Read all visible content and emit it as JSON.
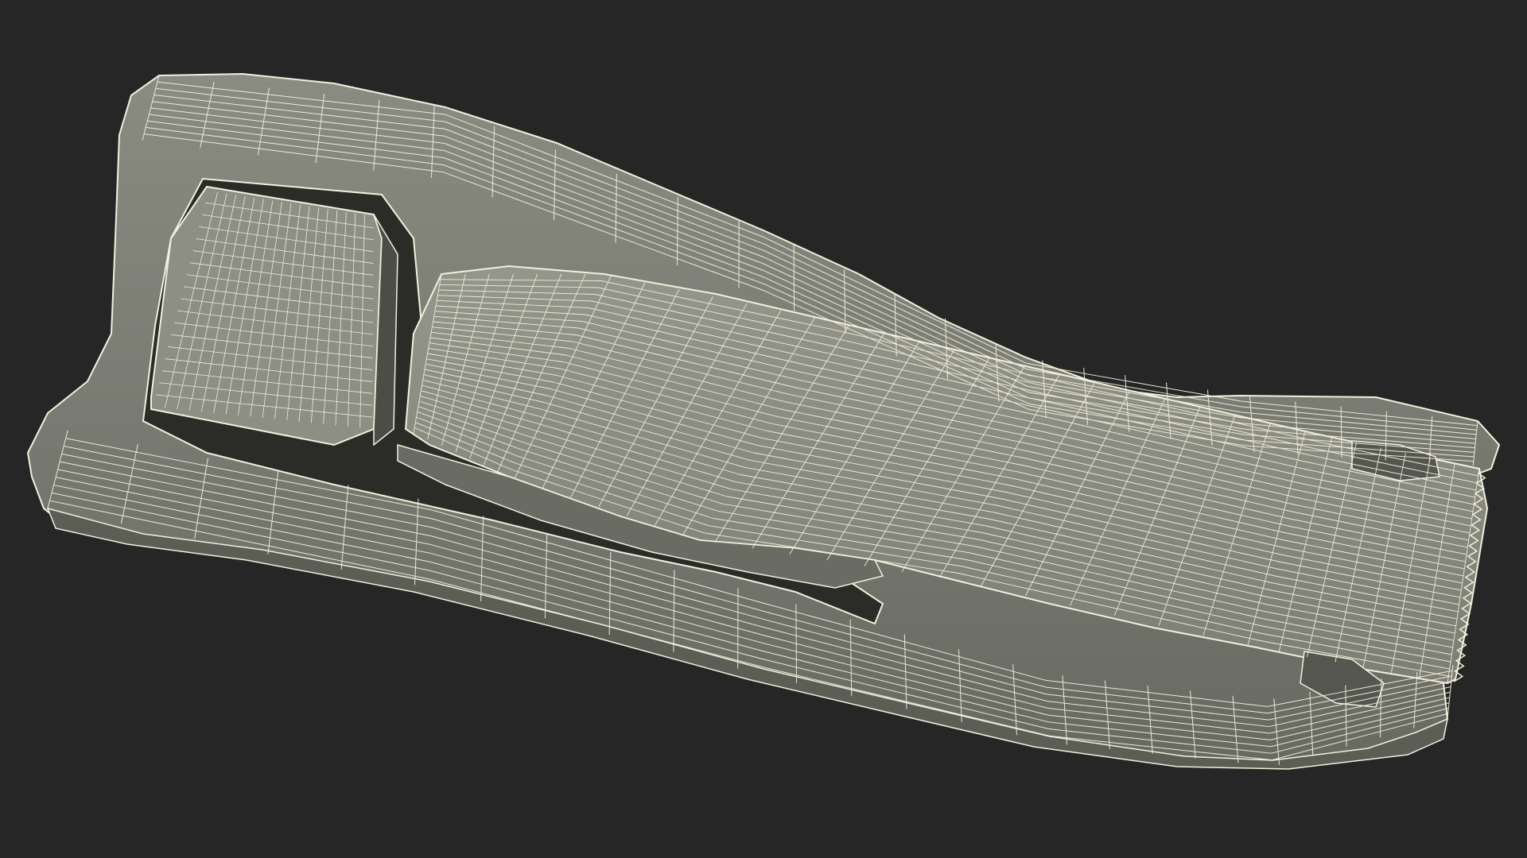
{
  "scene": {
    "subject": "tape-dispenser-wireframe",
    "colors": {
      "background": "#262626",
      "body_fill": "#7c7c72",
      "body_shade": "#5e5f57",
      "cavity": "#2b2b28",
      "tape_fill": "#8a8a7f",
      "wire": "#f2f0dc"
    }
  }
}
